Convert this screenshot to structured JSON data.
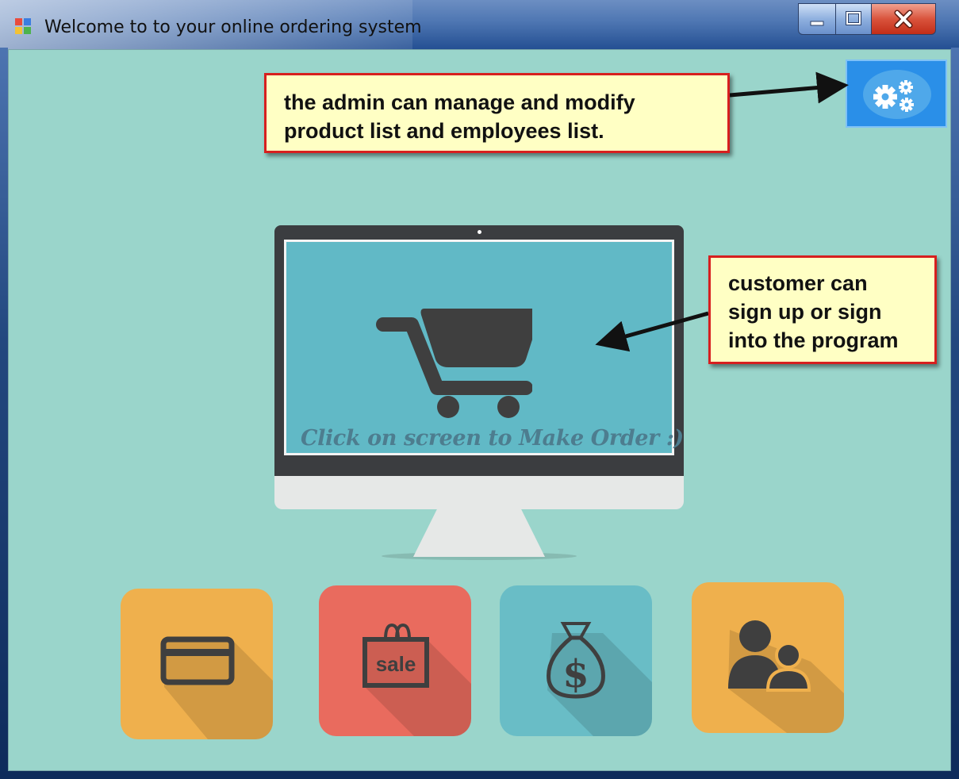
{
  "window": {
    "title": "Welcome to to your online ordering system",
    "icon": "app-window-icon",
    "controls": [
      "minimize-icon",
      "maximize-icon",
      "close-icon"
    ]
  },
  "admin": {
    "icon": "gears-icon"
  },
  "callouts": {
    "admin_lines": [
      "the admin can manage and modify",
      "product list and employees list."
    ],
    "customer_lines": [
      "customer can",
      "sign up or sign",
      "into the program"
    ]
  },
  "order_screen": {
    "icon": "shopping-cart-icon",
    "label": "Click on screen to Make Order :)"
  },
  "tiles": {
    "credit_card": {
      "icon": "credit-card-icon"
    },
    "sale": {
      "icon": "sale-bag-icon",
      "tag_text": "sale"
    },
    "money": {
      "icon": "money-bag-icon",
      "symbol": "$"
    },
    "users": {
      "icon": "users-icon"
    }
  },
  "colors": {
    "background": "#9ad5cb",
    "admin_button": "#2a8fe8",
    "callout_fill": "#ffffc4",
    "callout_border": "#d71f1f",
    "screen": "#61b9c6",
    "tile_orange": "#efb04d",
    "tile_red": "#e96b5e",
    "tile_teal": "#69bdc6",
    "icon_dark": "#3f3f3f"
  }
}
